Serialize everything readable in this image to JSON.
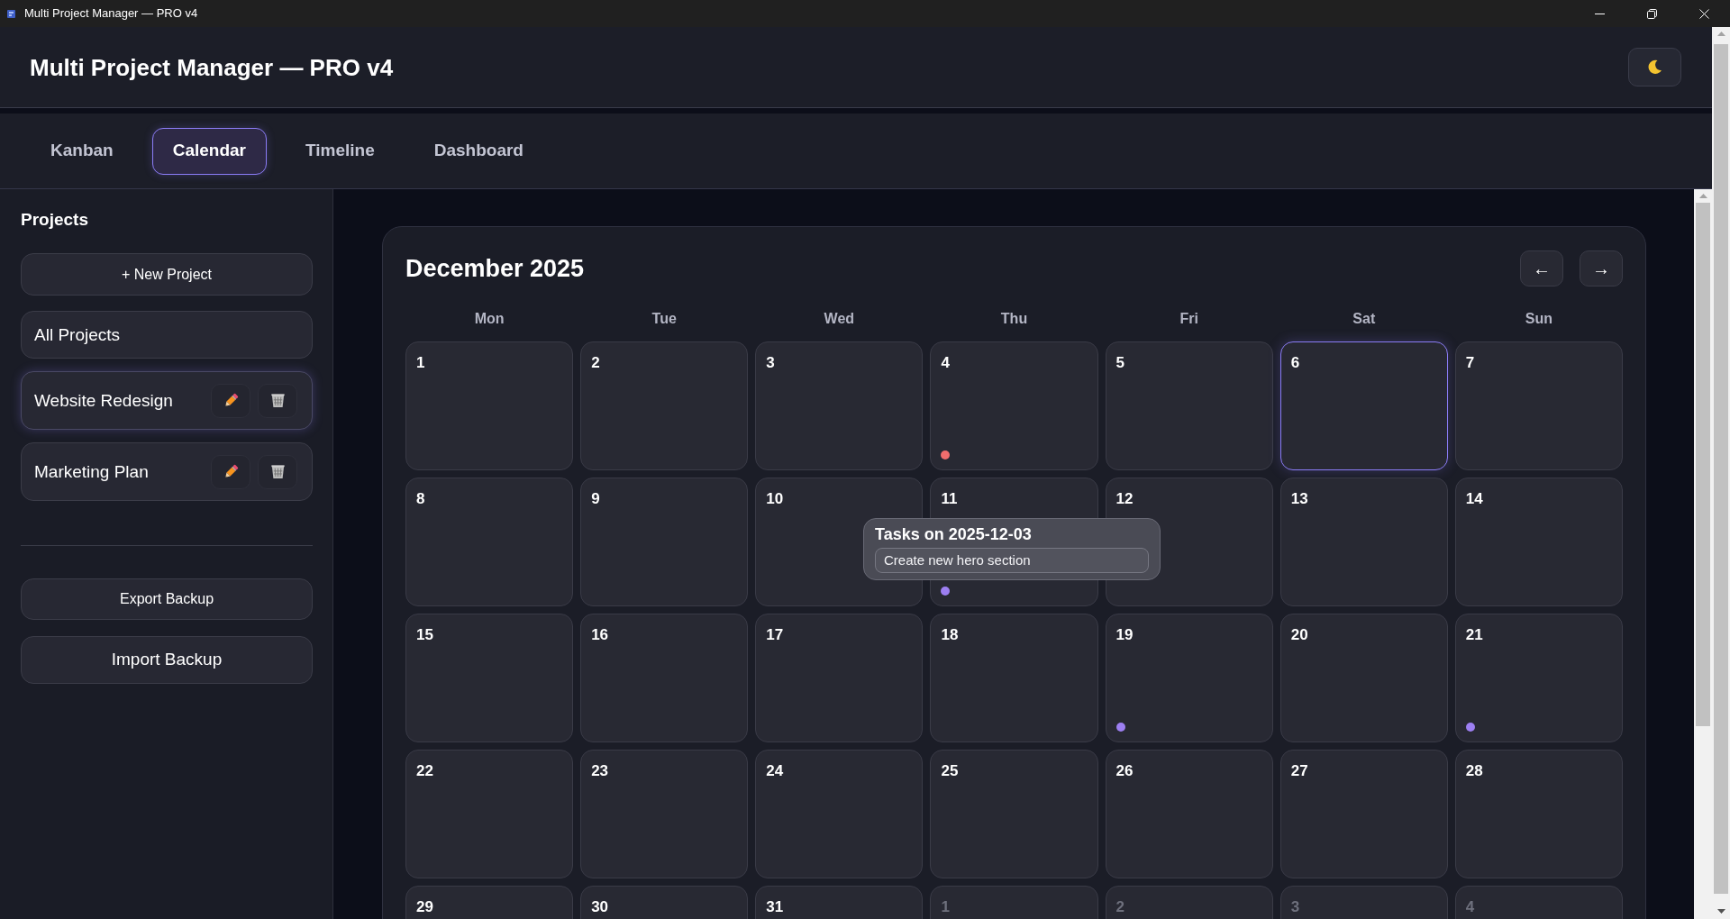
{
  "window": {
    "title": "Multi Project Manager — PRO v4"
  },
  "header": {
    "title": "Multi Project Manager — PRO v4"
  },
  "tabs": [
    {
      "label": "Kanban",
      "selected": false
    },
    {
      "label": "Calendar",
      "selected": true
    },
    {
      "label": "Timeline",
      "selected": false
    },
    {
      "label": "Dashboard",
      "selected": false
    }
  ],
  "sidebar": {
    "heading": "Projects",
    "new_project_label": "+ New Project",
    "projects": [
      {
        "name": "All Projects",
        "kind": "all",
        "selected": false
      },
      {
        "name": "Website Redesign",
        "kind": "project",
        "selected": true
      },
      {
        "name": "Marketing Plan",
        "kind": "project",
        "selected": false
      }
    ],
    "backup_buttons": [
      "Export Backup",
      "Import Backup"
    ]
  },
  "calendar": {
    "title": "December 2025",
    "nav_buttons": [
      "←",
      "→"
    ],
    "weekdays": [
      "Mon",
      "Tue",
      "Wed",
      "Thu",
      "Fri",
      "Sat",
      "Sun"
    ],
    "days": [
      {
        "day": "1",
        "in_month": true,
        "today": false
      },
      {
        "day": "2",
        "in_month": true,
        "today": false
      },
      {
        "day": "3",
        "in_month": true,
        "today": false
      },
      {
        "day": "4",
        "in_month": true,
        "today": false,
        "dots": [
          {
            "color": "#f26d6d"
          }
        ]
      },
      {
        "day": "5",
        "in_month": true,
        "today": false
      },
      {
        "day": "6",
        "in_month": true,
        "today": true
      },
      {
        "day": "7",
        "in_month": true,
        "today": false
      },
      {
        "day": "8",
        "in_month": true,
        "today": false
      },
      {
        "day": "9",
        "in_month": true,
        "today": false
      },
      {
        "day": "10",
        "in_month": true,
        "today": false
      },
      {
        "day": "11",
        "in_month": true,
        "today": false,
        "dots": [
          {
            "color": "#9d7ff2"
          }
        ]
      },
      {
        "day": "12",
        "in_month": true,
        "today": false
      },
      {
        "day": "13",
        "in_month": true,
        "today": false
      },
      {
        "day": "14",
        "in_month": true,
        "today": false
      },
      {
        "day": "15",
        "in_month": true,
        "today": false
      },
      {
        "day": "16",
        "in_month": true,
        "today": false
      },
      {
        "day": "17",
        "in_month": true,
        "today": false
      },
      {
        "day": "18",
        "in_month": true,
        "today": false
      },
      {
        "day": "19",
        "in_month": true,
        "today": false,
        "dots": [
          {
            "color": "#9d7ff2"
          }
        ]
      },
      {
        "day": "20",
        "in_month": true,
        "today": false
      },
      {
        "day": "21",
        "in_month": true,
        "today": false,
        "dots": [
          {
            "color": "#9d7ff2"
          }
        ]
      },
      {
        "day": "22",
        "in_month": true,
        "today": false
      },
      {
        "day": "23",
        "in_month": true,
        "today": false
      },
      {
        "day": "24",
        "in_month": true,
        "today": false
      },
      {
        "day": "25",
        "in_month": true,
        "today": false
      },
      {
        "day": "26",
        "in_month": true,
        "today": false
      },
      {
        "day": "27",
        "in_month": true,
        "today": false
      },
      {
        "day": "28",
        "in_month": true,
        "today": false
      },
      {
        "day": "29",
        "in_month": true,
        "today": false
      },
      {
        "day": "30",
        "in_month": true,
        "today": false
      },
      {
        "day": "31",
        "in_month": true,
        "today": false
      },
      {
        "day": "1",
        "in_month": false,
        "today": false
      },
      {
        "day": "2",
        "in_month": false,
        "today": false
      },
      {
        "day": "3",
        "in_month": false,
        "today": false
      },
      {
        "day": "4",
        "in_month": false,
        "today": false
      }
    ]
  },
  "task_popup": {
    "title": "Tasks on 2025-12-03",
    "tasks": [
      "Create new hero section"
    ]
  }
}
